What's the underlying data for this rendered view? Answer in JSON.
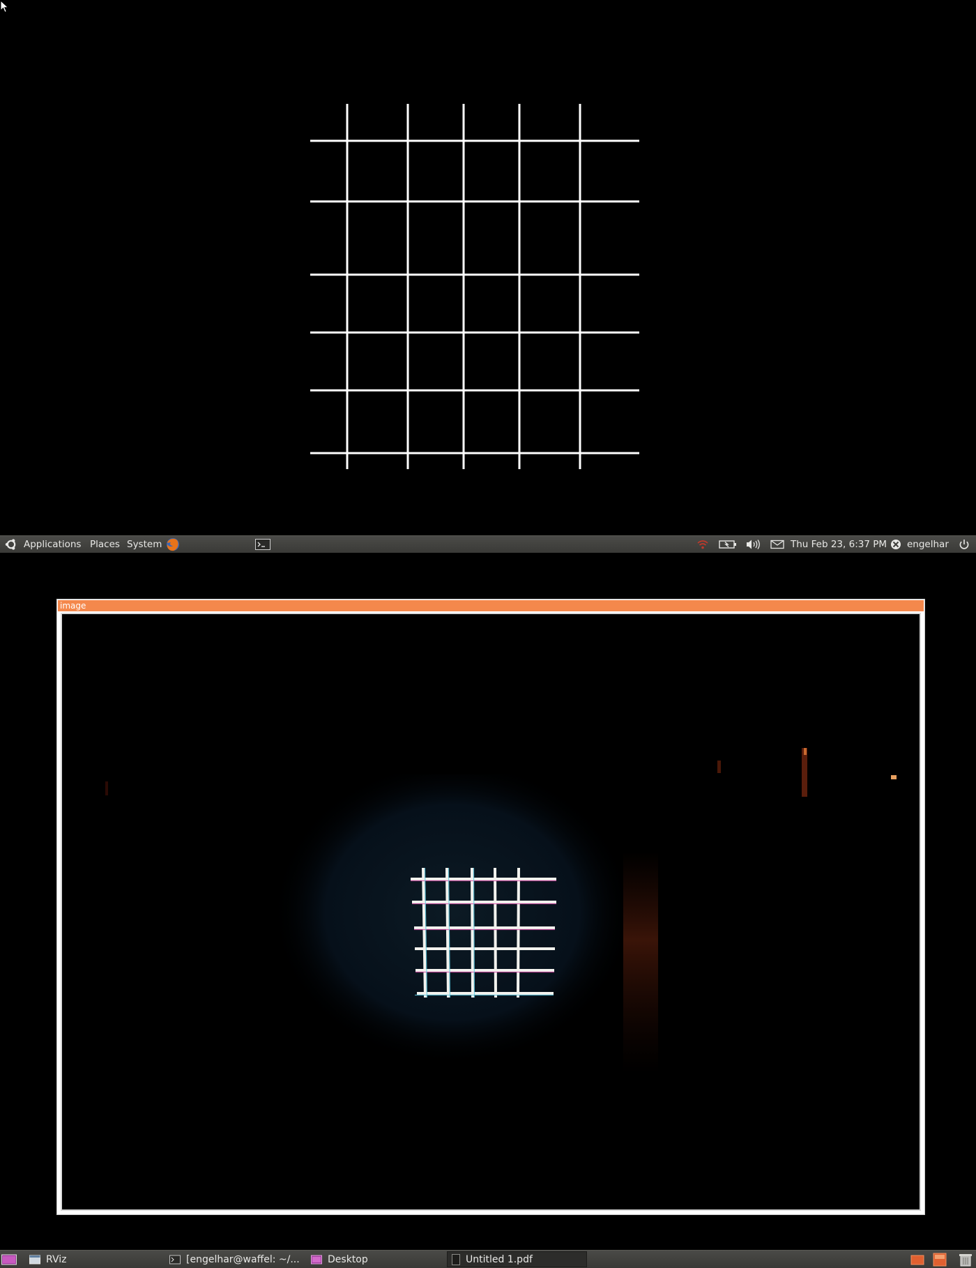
{
  "top_panel": {
    "menus": [
      "Applications",
      "Places",
      "System"
    ],
    "clock": "Thu Feb 23,  6:37 PM",
    "user": "engelhar",
    "icons": [
      "ubuntu-logo-icon",
      "firefox-icon",
      "terminal-icon",
      "network-icon",
      "battery-icon",
      "volume-icon",
      "mail-icon",
      "user-icon",
      "power-icon"
    ]
  },
  "image_window": {
    "title": "image"
  },
  "bottom_panel": {
    "tasks": [
      {
        "label": "RViz",
        "icon": "window-icon",
        "active": false
      },
      {
        "label": "[engelhar@waffel: ~/...",
        "icon": "terminal-icon",
        "active": false
      },
      {
        "label": "Desktop",
        "icon": "desktop-icon",
        "active": false
      },
      {
        "label": "Untitled 1.pdf",
        "icon": "document-icon",
        "active": true
      }
    ],
    "icons": [
      "show-desktop-icon",
      "workspace-switcher-icon",
      "trash-icon"
    ]
  },
  "colors": {
    "panel": "#3e3e3b",
    "titlebar_accent": "#f4884c",
    "grid_line": "#ffffff"
  }
}
